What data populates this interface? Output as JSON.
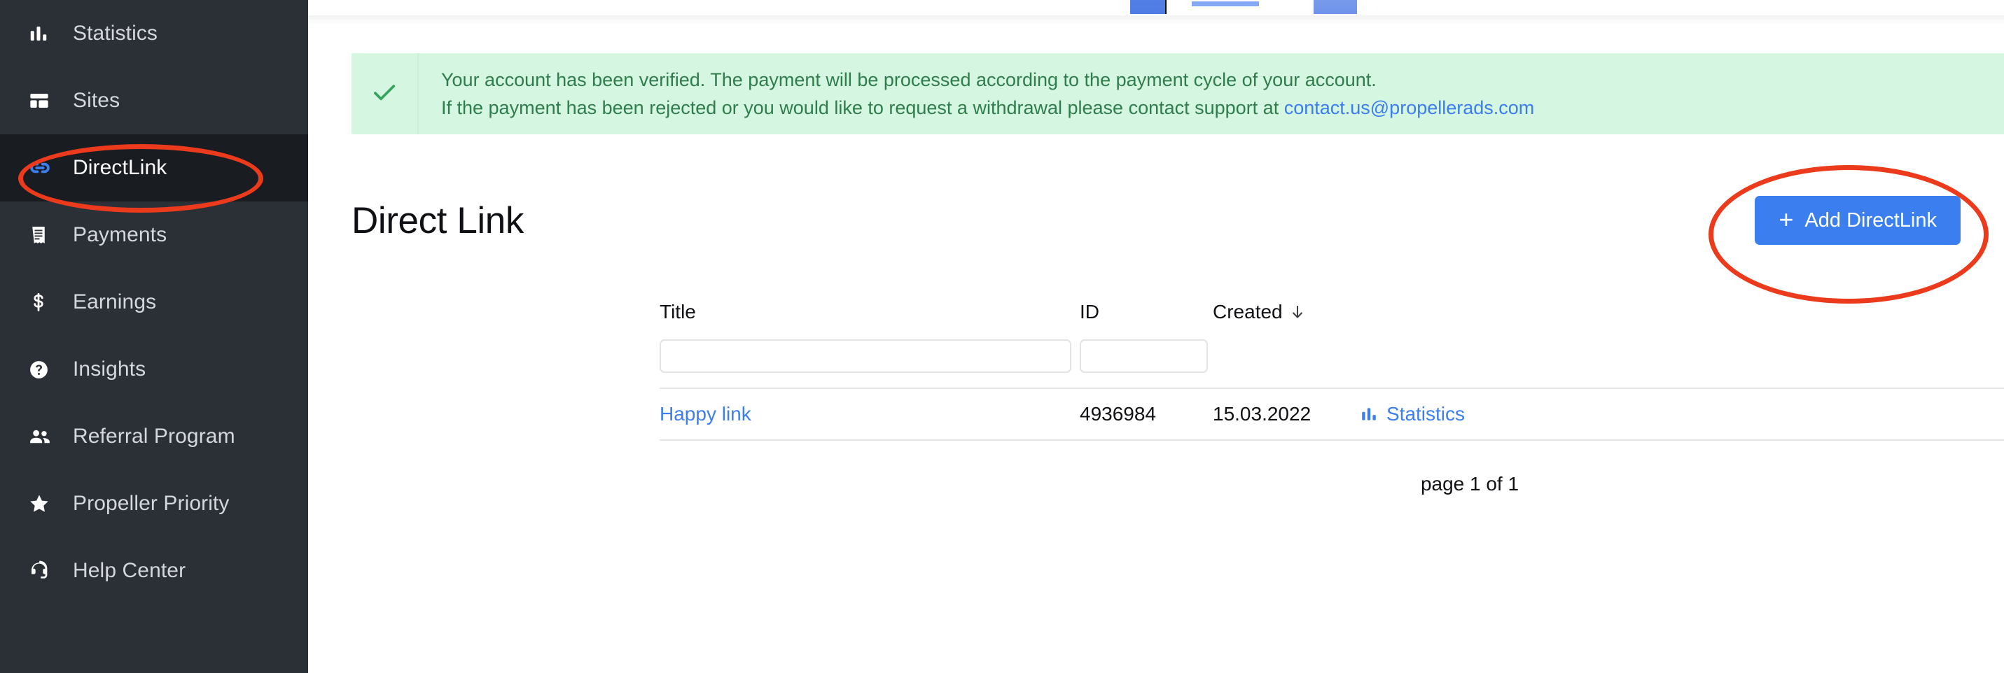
{
  "sidebar": {
    "items": [
      {
        "label": "Statistics",
        "icon": "bar-chart-icon",
        "active": false
      },
      {
        "label": "Sites",
        "icon": "layout-icon",
        "active": false
      },
      {
        "label": "DirectLink",
        "icon": "link-icon",
        "active": true
      },
      {
        "label": "Payments",
        "icon": "receipt-icon",
        "active": false
      },
      {
        "label": "Earnings",
        "icon": "dollar-icon",
        "active": false
      },
      {
        "label": "Insights",
        "icon": "question-mark-icon",
        "active": false
      },
      {
        "label": "Referral Program",
        "icon": "people-icon",
        "active": false
      },
      {
        "label": "Propeller Priority",
        "icon": "star-icon",
        "active": false
      },
      {
        "label": "Help Center",
        "icon": "headset-icon",
        "active": false
      }
    ]
  },
  "banner": {
    "icon": "check-icon",
    "line1": "Your account has been verified. The payment will be processed according to the payment cycle of your account.",
    "line2_prefix": "If the payment has been rejected or you would like to request a withdrawal please contact support at ",
    "support_email": "contact.us@propellerads.com",
    "close_icon": "close-icon",
    "bg_color": "#d5f7e1",
    "text_color": "#2f7d4c",
    "link_color": "#3b7ef0"
  },
  "page": {
    "title": "Direct Link",
    "add_button_label": "Add DirectLink",
    "add_button_icon": "plus-icon",
    "accent_color": "#3b7ef0"
  },
  "table": {
    "columns": [
      {
        "key": "title",
        "label": "Title",
        "sorted": false
      },
      {
        "key": "id",
        "label": "ID",
        "sorted": false
      },
      {
        "key": "created",
        "label": "Created",
        "sorted": true,
        "sort_direction": "desc",
        "sort_icon": "arrow-down-icon"
      },
      {
        "key": "actions",
        "label": "",
        "sorted": false
      }
    ],
    "filters": {
      "title_value": "",
      "title_placeholder": "",
      "id_value": "",
      "id_placeholder": ""
    },
    "rows": [
      {
        "title": "Happy link",
        "id": "4936984",
        "created": "15.03.2022",
        "action_label": "Statistics",
        "action_icon": "bar-chart-icon"
      }
    ]
  },
  "pagination": {
    "text": "page 1 of 1"
  },
  "annotations": {
    "color": "#ec3b1c",
    "items": [
      {
        "name": "directlink-sidebar-highlight",
        "shape": "ellipse"
      },
      {
        "name": "add-directlink-highlight",
        "shape": "ellipse"
      }
    ]
  }
}
